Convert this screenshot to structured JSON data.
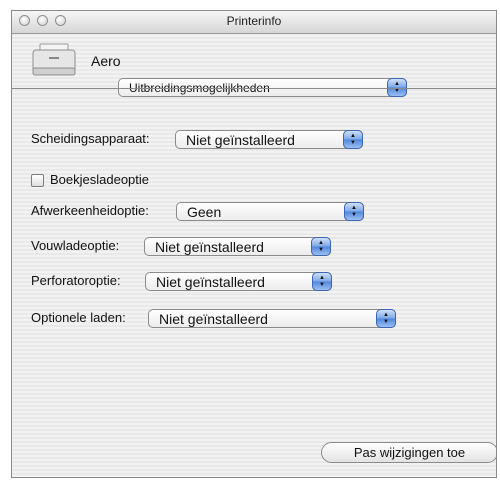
{
  "window": {
    "title": "Printerinfo"
  },
  "printer": {
    "name": "Aero"
  },
  "category_select": {
    "value": "Uitbreidingsmogelijkheden"
  },
  "options": {
    "separator": {
      "label": "Scheidingsapparaat:",
      "value": "Niet geïnstalleerd"
    },
    "booklet": {
      "label": "Boekjesladeoptie",
      "checked": false
    },
    "finisher": {
      "label": "Afwerkeenheidoptie:",
      "value": "Geen"
    },
    "folding": {
      "label": "Vouwladeoptie:",
      "value": "Niet geïnstalleerd"
    },
    "perforator": {
      "label": "Perforatoroptie:",
      "value": "Niet geïnstalleerd"
    },
    "trays": {
      "label": "Optionele laden:",
      "value": "Niet geïnstalleerd"
    }
  },
  "actions": {
    "apply_label": "Pas wijzigingen toe"
  },
  "colors": {
    "accent": "#4e86dd",
    "border": "#8b8b8b"
  }
}
